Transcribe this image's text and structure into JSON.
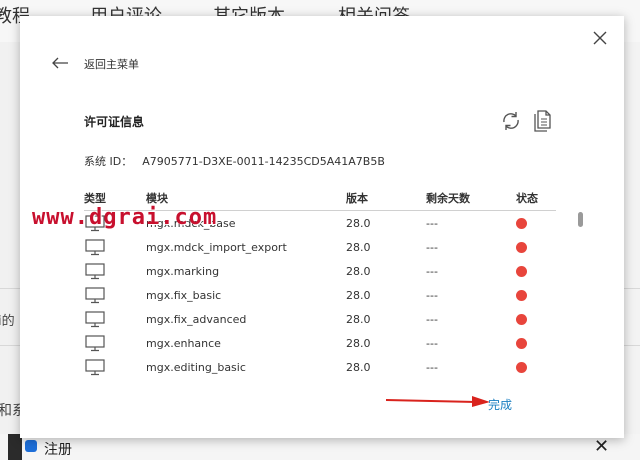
{
  "background": {
    "tabs": [
      "教程",
      "用户评论",
      "其它版本",
      "相关问答"
    ],
    "frag_left_1": "i的",
    "frag_left_2": "和系",
    "register_label": "注册",
    "close_glyph": "✕"
  },
  "dialog": {
    "back_label": "返回主菜单",
    "section_title": "许可证信息",
    "system_id_label": "系统 ID：",
    "system_id_value": "A7905771-D3XE-0011-14235CD5A41A7B5B",
    "columns": {
      "type": "类型",
      "module": "模块",
      "version": "版本",
      "days": "剩余天数",
      "status": "状态"
    },
    "rows": [
      {
        "module": "mgx.mdck_base",
        "version": "28.0",
        "days": "---"
      },
      {
        "module": "mgx.mdck_import_export",
        "version": "28.0",
        "days": "---"
      },
      {
        "module": "mgx.marking",
        "version": "28.0",
        "days": "---"
      },
      {
        "module": "mgx.fix_basic",
        "version": "28.0",
        "days": "---"
      },
      {
        "module": "mgx.fix_advanced",
        "version": "28.0",
        "days": "---"
      },
      {
        "module": "mgx.enhance",
        "version": "28.0",
        "days": "---"
      },
      {
        "module": "mgx.editing_basic",
        "version": "28.0",
        "days": "---"
      }
    ],
    "done_label": "完成"
  },
  "watermark": "www.dgrai.com",
  "colors": {
    "status_red": "#e8453c",
    "link_blue": "#1a7fc1",
    "annotation_red": "#d9231d"
  }
}
